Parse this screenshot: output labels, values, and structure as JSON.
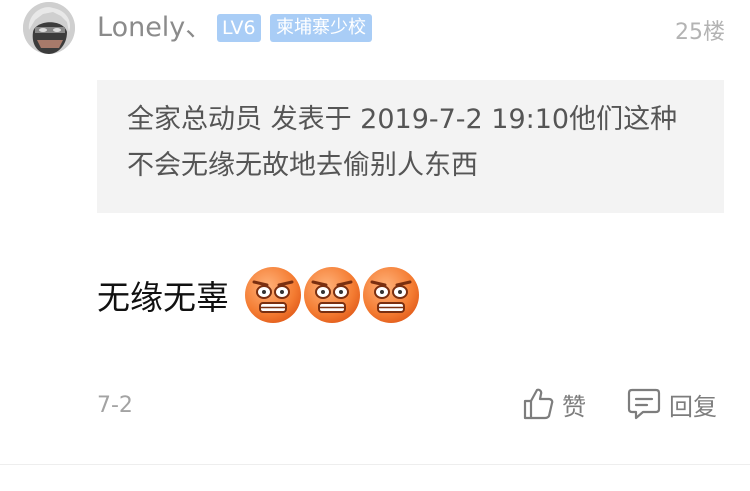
{
  "user": {
    "name": "Lonely、",
    "level": "LV6",
    "group": "柬埔寨少校",
    "avatar_icon": "avatar-masked-face"
  },
  "floor": "25楼",
  "quote": {
    "text": "全家总动员 发表于 2019-7-2 19:10他们这种不会无缘无故地去偷别人东西"
  },
  "content": {
    "text": "无缘无辜",
    "emojis": [
      "scared-face-emoji",
      "scared-face-emoji",
      "scared-face-emoji"
    ]
  },
  "meta": {
    "date": "7-2"
  },
  "actions": {
    "like_label": "赞",
    "reply_label": "回复",
    "like_icon": "thumbs-up-icon",
    "reply_icon": "comment-bubble-icon"
  },
  "colors": {
    "badge_bg": "#a9cdf6",
    "username": "#8b8b8b",
    "quote_bg": "#f3f3f3",
    "emoji_orange": "#f5893f"
  }
}
